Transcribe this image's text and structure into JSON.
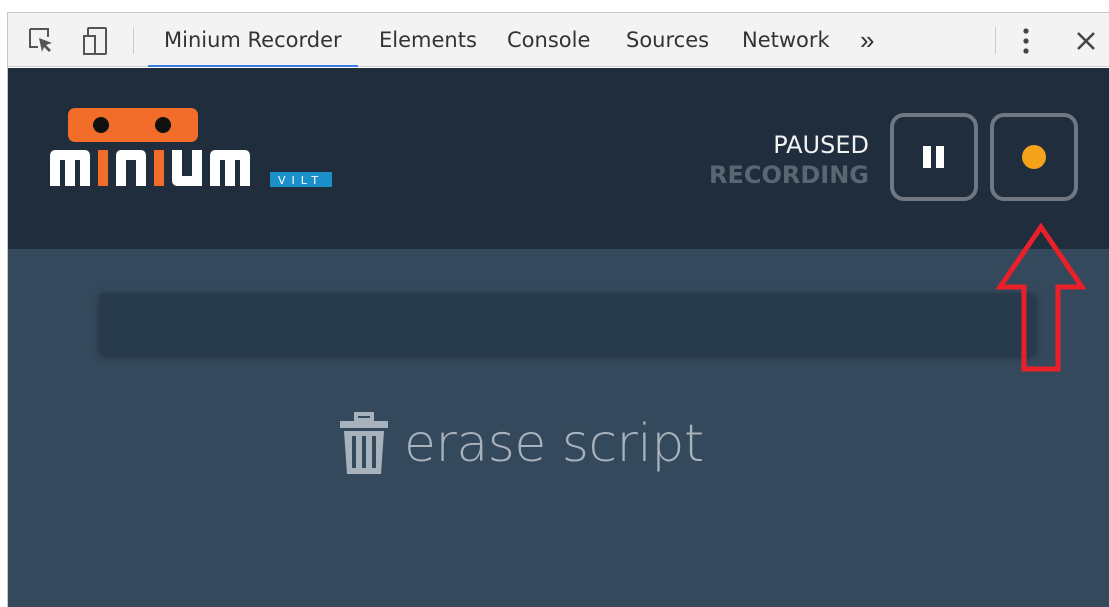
{
  "devtools": {
    "tabs": [
      {
        "label": "Minium Recorder",
        "active": true
      },
      {
        "label": "Elements",
        "active": false
      },
      {
        "label": "Console",
        "active": false
      },
      {
        "label": "Sources",
        "active": false
      },
      {
        "label": "Network",
        "active": false
      }
    ],
    "more_tabs_label": "»",
    "icons": [
      "inspect-element-icon",
      "device-toolbar-icon",
      "kebab-menu-icon",
      "close-icon"
    ],
    "accent_color": "#3b7de0"
  },
  "recorder": {
    "logo": {
      "wordmark": "minium",
      "sub": "VILT",
      "brand_color": "#f26c2a",
      "sub_color": "#1b8fc9"
    },
    "status": {
      "main": "PAUSED",
      "sub": "RECORDING"
    },
    "buttons": {
      "pause_icon": "pause-icon",
      "record_icon": "record-icon",
      "record_color": "#f5a31a"
    },
    "script_input": {
      "value": "",
      "placeholder": ""
    },
    "erase": {
      "label": "erase script",
      "icon": "trash-icon"
    },
    "colors": {
      "header_bg": "#1f2d3d",
      "content_bg": "#34495c"
    }
  },
  "annotation": {
    "type": "red-arrow-up",
    "color": "#e8202a",
    "points_to": "record-button"
  }
}
